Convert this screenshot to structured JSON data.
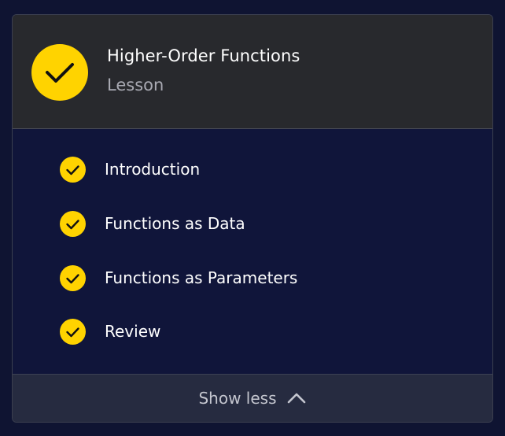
{
  "lesson": {
    "title": "Higher-Order Functions",
    "type": "Lesson",
    "status_icon": "check-circle-icon",
    "accent_color": "#ffd300"
  },
  "items": [
    {
      "label": "Introduction",
      "completed": true
    },
    {
      "label": "Functions as Data",
      "completed": true
    },
    {
      "label": "Functions as Parameters",
      "completed": true
    },
    {
      "label": "Review",
      "completed": true
    }
  ],
  "footer": {
    "toggle_label": "Show less",
    "toggle_icon": "chevron-up-icon"
  }
}
